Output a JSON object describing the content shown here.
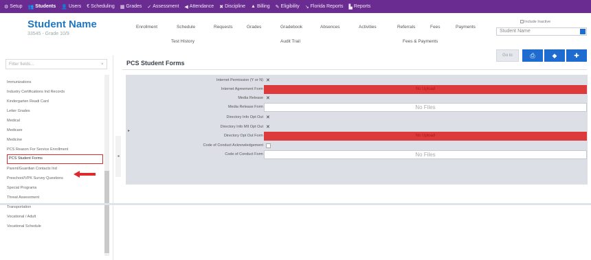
{
  "topnav": [
    {
      "icon": "setup-icon",
      "glyph": "⚙",
      "label": "Setup",
      "active": false
    },
    {
      "icon": "students-icon",
      "glyph": "👥",
      "label": "Students",
      "active": true
    },
    {
      "icon": "users-icon",
      "glyph": "👤",
      "label": "Users",
      "active": false
    },
    {
      "icon": "scheduling-icon",
      "glyph": "€",
      "label": "Scheduling",
      "active": false
    },
    {
      "icon": "grades-icon",
      "glyph": "▦",
      "label": "Grades",
      "active": false
    },
    {
      "icon": "assessment-icon",
      "glyph": "✓",
      "label": "Assessment",
      "active": false
    },
    {
      "icon": "attendance-icon",
      "glyph": "◀",
      "label": "Attendance",
      "active": false
    },
    {
      "icon": "discipline-icon",
      "glyph": "✖",
      "label": "Discipline",
      "active": false
    },
    {
      "icon": "billing-icon",
      "glyph": "▲",
      "label": "Billing",
      "active": false
    },
    {
      "icon": "eligibility-icon",
      "glyph": "✎",
      "label": "Eligibility",
      "active": false
    },
    {
      "icon": "florida-reports-icon",
      "glyph": "↘",
      "label": "Florida Reports",
      "active": false
    },
    {
      "icon": "reports-icon",
      "glyph": "▙",
      "label": "Reports",
      "active": false
    }
  ],
  "header": {
    "student_name": "Student Name",
    "student_sub": "33545 - Grade 10/9",
    "links_row1": [
      "Enrollment",
      "Schedule",
      "Requests",
      "Grades",
      "Gradebook",
      "Absences",
      "Activities",
      "Referrals",
      "Fees",
      "Payments"
    ],
    "links_row2": [
      "Test History",
      "Audit Trail",
      "Fees & Payments"
    ],
    "search_label": "Include Inactive",
    "search_placeholder": "Student Name",
    "goto_label": "Go to",
    "buttons": [
      {
        "name": "print-button",
        "glyph": "⎙"
      },
      {
        "name": "previous-student-button",
        "glyph": "◆"
      },
      {
        "name": "next-student-button",
        "glyph": "✚"
      }
    ]
  },
  "sidebar": {
    "filter_placeholder": "Filter fields...",
    "filter_clear": "×",
    "items": [
      "Immunizations",
      "Industry Certifications Ind Records",
      "Kindergarten Readi Card",
      "Letter Grades",
      "Medical",
      "Medicare",
      "Medicine",
      "PCS Reason For Service Enrollment",
      "PCS Student Forms",
      "Parent/Guardian Contacts Ind",
      "Preschool/VPK Survey Questions",
      "Special Programs",
      "Threat Assessment",
      "Transportation",
      "Vocational / Adult",
      "Vocational Schedule"
    ],
    "active_index": 8,
    "collapse_glyph": "◂"
  },
  "main": {
    "title": "PCS Student Forms",
    "collapse_glyph": "▸",
    "rows": [
      {
        "label": "Internet Permission (Y or N)",
        "kind": "check",
        "checked": true
      },
      {
        "label": "Internet Agreement Form",
        "kind": "red",
        "text": "No Upload"
      },
      {
        "label": "Media Release",
        "kind": "check",
        "checked": true
      },
      {
        "label": "Media Release Form",
        "kind": "files",
        "text": "No Files"
      },
      {
        "label": "Directory Info Opt Out",
        "kind": "check",
        "checked": true
      },
      {
        "label": "Directory Info MIl Opt Out",
        "kind": "check",
        "checked": true
      },
      {
        "label": "Directory Opt Out Form",
        "kind": "red",
        "text": "No Upload"
      },
      {
        "label": "Code of Conduct Acknowledgement",
        "kind": "check",
        "checked": false
      },
      {
        "label": "Code of Conduct Form",
        "kind": "files",
        "text": "No Files"
      }
    ]
  },
  "colors": {
    "nav_purple": "#6a2c91",
    "name_blue": "#1f77c4",
    "button_blue": "#1e6ccf",
    "upload_red": "#dd3b3b",
    "highlight_red": "#e0292c"
  }
}
